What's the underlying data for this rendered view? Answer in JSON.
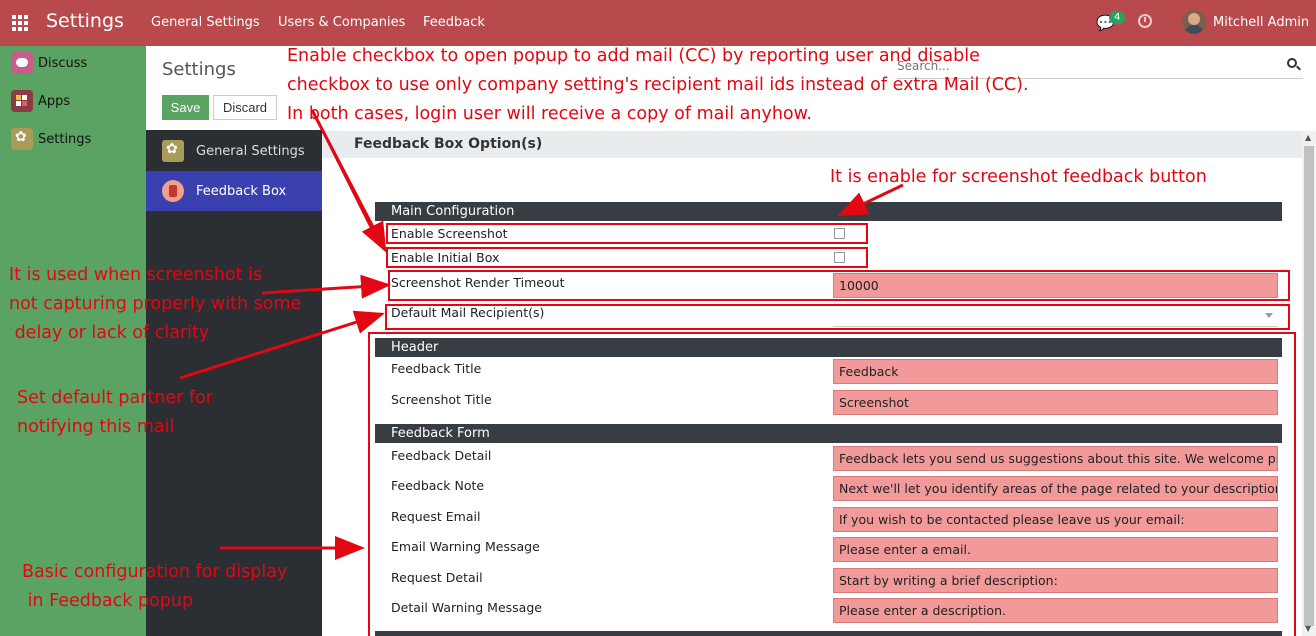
{
  "navbar": {
    "app_title": "Settings",
    "menu": [
      "General Settings",
      "Users & Companies",
      "Feedback"
    ],
    "chat_badge": "4",
    "user_name": "Mitchell Admin"
  },
  "apps": [
    "Discuss",
    "Apps",
    "Settings"
  ],
  "control_panel": {
    "title": "Settings",
    "save_label": "Save",
    "discard_label": "Discard",
    "search_placeholder": "Search..."
  },
  "settings_nav": [
    "General Settings",
    "Feedback Box"
  ],
  "section_title": "Feedback Box Option(s)",
  "main_config": {
    "title": "Main Configuration",
    "enable_screenshot": "Enable Screenshot",
    "enable_initial_box": "Enable Initial Box",
    "render_timeout_label": "Screenshot Render Timeout",
    "render_timeout_value": "10000",
    "default_recipients_label": "Default Mail Recipient(s)"
  },
  "header_group": {
    "title": "Header",
    "fields": [
      {
        "label": "Feedback Title",
        "value": "Feedback"
      },
      {
        "label": "Screenshot Title",
        "value": "Screenshot"
      }
    ]
  },
  "form_group": {
    "title": "Feedback Form",
    "fields": [
      {
        "label": "Feedback Detail",
        "value": "Feedback lets you send us suggestions about this site. We welcome problems"
      },
      {
        "label": "Feedback Note",
        "value": "Next we'll let you identify areas of the page related to your description."
      },
      {
        "label": "Request Email",
        "value": "If you wish to be contacted please leave us your email:"
      },
      {
        "label": "Email Warning Message",
        "value": "Please enter a email."
      },
      {
        "label": "Request Detail",
        "value": "Start by writing a brief description:"
      },
      {
        "label": "Detail Warning Message",
        "value": "Please enter a description."
      }
    ]
  },
  "annotations": {
    "cc_note": [
      "Enable checkbox to open popup to add mail (CC) by reporting user and disable",
      "checkbox to use only company setting's recipient mail ids instead of extra Mail (CC).",
      "In both cases, login user will receive a copy of mail anyhow."
    ],
    "screenshot_note": "It is enable for screenshot feedback button",
    "timeout_note": [
      "It is used when screenshot is",
      "not capturing properly with some",
      " delay or lack of clarity"
    ],
    "partner_note": [
      "Set default partner for",
      "notifying this mail"
    ],
    "basic_note": [
      "Basic configuration for display",
      " in Feedback popup"
    ]
  },
  "colors": {
    "navbar": "#b8494c",
    "app_sidebar": "#5ba363",
    "settings_sidebar": "#2b2f33",
    "active_item": "#3b40b0",
    "field_fill": "#f29a9a",
    "annotation": "#e30613"
  }
}
